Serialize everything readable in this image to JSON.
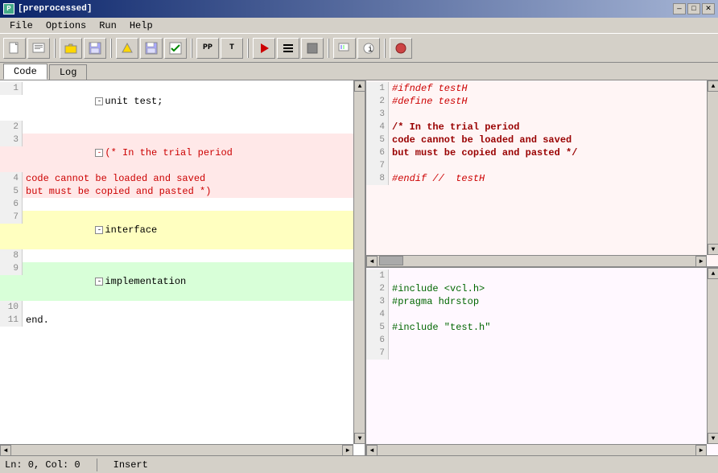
{
  "window": {
    "title": "[preprocessed]",
    "icon_label": "pp"
  },
  "titlebar": {
    "title": " [preprocessed]",
    "minimize_label": "—",
    "maximize_label": "□",
    "close_label": "✕"
  },
  "menubar": {
    "items": [
      "File",
      "Options",
      "Run",
      "Help"
    ]
  },
  "toolbar": {
    "buttons": [
      {
        "name": "new-btn",
        "icon": "📄",
        "label": ""
      },
      {
        "name": "open-recent-btn",
        "icon": "⊡",
        "label": ""
      },
      {
        "name": "open-btn",
        "icon": "📂",
        "label": ""
      },
      {
        "name": "save-btn",
        "icon": "💾",
        "label": ""
      },
      {
        "name": "browse-btn",
        "icon": "📁",
        "label": ""
      },
      {
        "name": "save2-btn",
        "icon": "💾",
        "label": ""
      },
      {
        "name": "check-btn",
        "icon": "☑",
        "label": ""
      },
      {
        "name": "pp-btn",
        "icon": "PP",
        "label": "PP"
      },
      {
        "name": "t-btn",
        "icon": "T",
        "label": "T"
      },
      {
        "name": "run-btn",
        "icon": "▶",
        "label": ""
      },
      {
        "name": "list-btn",
        "icon": "≡",
        "label": ""
      },
      {
        "name": "stop-btn",
        "icon": "⬜",
        "label": ""
      },
      {
        "name": "open3-btn",
        "icon": "⊞",
        "label": ""
      },
      {
        "name": "info-btn",
        "icon": "ℹ",
        "label": ""
      },
      {
        "name": "unit-btn",
        "icon": "◉",
        "label": ""
      }
    ]
  },
  "tabs": {
    "items": [
      "Code",
      "Log"
    ],
    "active": "Code"
  },
  "left_panel": {
    "lines": [
      {
        "num": 1,
        "content": "unit test;",
        "bg": "white",
        "parts": [
          {
            "text": "unit test;",
            "color": "black"
          }
        ]
      },
      {
        "num": 2,
        "content": "",
        "bg": "white"
      },
      {
        "num": 3,
        "content": "(* In the trial period",
        "bg": "pink",
        "parts": [
          {
            "text": "(* In the trial period",
            "color": "red"
          }
        ]
      },
      {
        "num": 4,
        "content": "code cannot be loaded and saved",
        "bg": "pink",
        "parts": [
          {
            "text": "code cannot be loaded and saved",
            "color": "red"
          }
        ]
      },
      {
        "num": 5,
        "content": "but must be copied and pasted *)",
        "bg": "pink",
        "parts": [
          {
            "text": "but must be copied and pasted *)",
            "color": "red"
          }
        ]
      },
      {
        "num": 6,
        "content": "",
        "bg": "white"
      },
      {
        "num": 7,
        "content": "interface",
        "bg": "yellow",
        "parts": [
          {
            "text": "interface",
            "color": "black"
          }
        ]
      },
      {
        "num": 8,
        "content": "",
        "bg": "white"
      },
      {
        "num": 9,
        "content": "implementation",
        "bg": "green",
        "parts": [
          {
            "text": "implementation",
            "color": "black"
          }
        ]
      },
      {
        "num": 10,
        "content": "",
        "bg": "white"
      },
      {
        "num": 11,
        "content": "end.",
        "bg": "white",
        "parts": [
          {
            "text": "end.",
            "color": "black"
          }
        ]
      }
    ]
  },
  "right_top_panel": {
    "lines": [
      {
        "num": 1,
        "content": "#ifndef testH",
        "color": "red",
        "italic": true
      },
      {
        "num": 2,
        "content": "#define testH",
        "color": "red",
        "italic": true
      },
      {
        "num": 3,
        "content": "",
        "color": "black"
      },
      {
        "num": 4,
        "content": "/* In the trial period",
        "color": "darkred",
        "bold": true
      },
      {
        "num": 5,
        "content": "code cannot be loaded and saved",
        "color": "darkred",
        "bold": true
      },
      {
        "num": 6,
        "content": "but must be copied and pasted */",
        "color": "darkred",
        "bold": true
      },
      {
        "num": 7,
        "content": "",
        "color": "black"
      },
      {
        "num": 8,
        "content": "#endif //  testH",
        "color": "red",
        "italic": true
      }
    ]
  },
  "right_bottom_panel": {
    "lines": [
      {
        "num": 1,
        "content": "",
        "color": "black"
      },
      {
        "num": 2,
        "content": "#include <vcl.h>",
        "color": "green"
      },
      {
        "num": 3,
        "content": "#pragma hdrstop",
        "color": "green"
      },
      {
        "num": 4,
        "content": "",
        "color": "black"
      },
      {
        "num": 5,
        "content": "#include \"test.h\"",
        "color": "green"
      },
      {
        "num": 6,
        "content": "",
        "color": "black"
      },
      {
        "num": 7,
        "content": "",
        "color": "black"
      }
    ]
  },
  "statusbar": {
    "position": "Ln: 0, Col: 0",
    "mode": "Insert"
  }
}
